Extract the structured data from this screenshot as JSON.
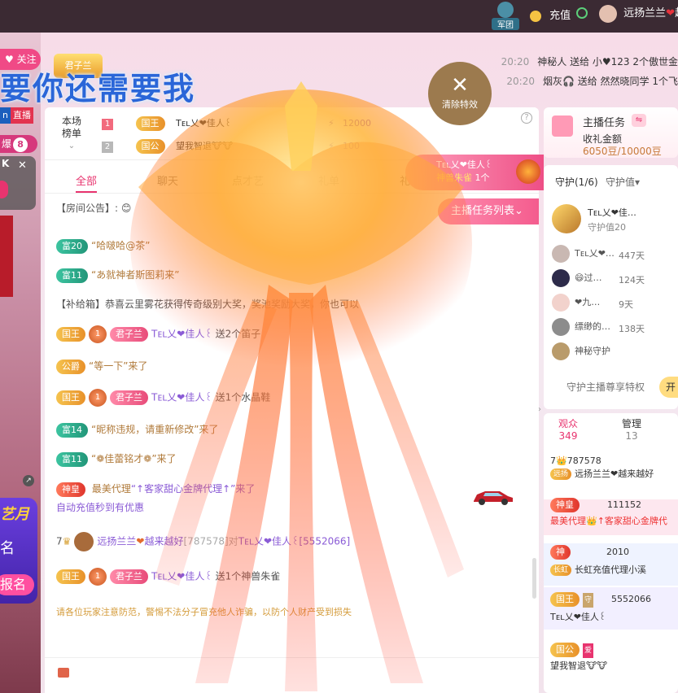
{
  "topbar": {
    "junbtuan": "军团",
    "recharge": "充值",
    "username": "远扬兰兰",
    "heart": "❤",
    "suffix": "越"
  },
  "left": {
    "follow": "关注",
    "live_n": "n",
    "live": "直播",
    "bao": "爆",
    "bao_count": "8",
    "k": "K",
    "close": "✕",
    "promo_title": "艺月",
    "promo_name": "名",
    "promo_btn": "报名"
  },
  "banner": {
    "text": "要你还需要我",
    "badge": "君子兰"
  },
  "ticker": [
    {
      "time": "20:20",
      "text": "神秘人 送给 小♥123 2个傲世金"
    },
    {
      "time": "20:20",
      "text": "烟灰🎧 送给 然然晓同学 1个飞"
    }
  ],
  "clear_effects": {
    "icon": "✕",
    "label": "清除特效"
  },
  "rank": {
    "title": "本场榜单",
    "help": "?",
    "rows": [
      {
        "num": "1",
        "title": "国王",
        "name": "Tᴇʟ乂❤佳人꒰",
        "score": "12000"
      },
      {
        "num": "2",
        "title": "国公",
        "name": "望我智退🐮🐮",
        "score": "100"
      }
    ]
  },
  "tabs": [
    "全部",
    "聊天",
    "点才艺",
    "礼单",
    "礼"
  ],
  "gift_popup": {
    "user": "Tᴇʟ乂❤佳人꒰",
    "gift": "神兽朱雀",
    "count": "1个"
  },
  "anchor_task_list": "主播任务列表",
  "messages": {
    "notice": "【房间公告】:",
    "m1_badge": "富20",
    "m1": "“哈啵哈@茶”",
    "m2_badge": "富11",
    "m2": "“あ就神者斯图莉来”",
    "m3": "【补给箱】恭喜云里雾花获得传奇级别大奖，奖池奖励大奖，你也可以",
    "m4_title": "国王",
    "m4_lv": "1",
    "m4_club": "君子兰",
    "m4_user": "Tᴇʟ乂❤佳人꒰",
    "m4": "送2个笛子",
    "m5_title": "公爵",
    "m5": "“等一下”来了",
    "m6_title": "国王",
    "m6_lv": "1",
    "m6_club": "君子兰",
    "m6_user": "Tᴇʟ乂❤佳人꒰",
    "m6": "送1个水晶鞋",
    "m7_badge": "富14",
    "m7": "“昵称违规，请重新修改”来了",
    "m8_badge": "富11",
    "m8": "“❁佳蕾铭才❁”来了",
    "m9_title": "神皇",
    "m9_agent": "最美代理",
    "m9": "“↑客家甜心金牌代理↑”来了",
    "m9b": "自动充值秒到有优惠",
    "m10_rank": "7",
    "m10_user": "远扬兰兰",
    "m10": "越来越好",
    "m10_mid": "[787578]对",
    "m10_to": "Tᴇʟ乂❤佳人꒰[5552066]",
    "m11_title": "国王",
    "m11_lv": "1",
    "m11_club": "君子兰",
    "m11_user": "Tᴇʟ乂❤佳人꒰",
    "m11": "送1个神兽朱雀",
    "warning": "请各位玩家注意防范，警惕不法分子冒充他人诈骗，以防个人财产受到损失"
  },
  "task_card": {
    "title": "主播任务",
    "sub": "收礼金额",
    "progress": "6050豆/10000豆"
  },
  "guard": {
    "tab1": "守护(1/6)",
    "tab2": "守护值",
    "top_name": "Tᴇʟ乂❤佳…",
    "top_val": "守护值20",
    "rows": [
      {
        "name": "Tᴇʟ乂❤…",
        "days": "447天"
      },
      {
        "name": "😄过…",
        "days": "124天"
      },
      {
        "name": "❤九…",
        "days": "9天"
      },
      {
        "name": "缥缈的…",
        "days": "138天"
      },
      {
        "name": "神秘守护",
        "days": ""
      }
    ],
    "privilege": "守护主播尊享特权",
    "open": "开"
  },
  "audience": {
    "tab1": "观众",
    "tab1_count": "349",
    "tab2": "管理",
    "tab2_count": "13",
    "rows": [
      {
        "line1": "7👑787578",
        "line2": "远扬兰兰❤越来越好",
        "tag": "远扬"
      },
      {
        "title": "神皇",
        "id": "111152",
        "line2": "最美代理👑↑客家甜心金牌代"
      },
      {
        "title": "神",
        "id": "2010",
        "line2": "长虹充值代理小溪",
        "tag": "长虹"
      },
      {
        "title": "国王",
        "tag": "守",
        "id": "5552066",
        "line2": "Tᴇʟ乂❤佳人꒰"
      },
      {
        "title": "国公",
        "tag": "爱",
        "line2": "望我智退🐮🐮"
      }
    ]
  },
  "colors": {
    "accent": "#e8346f",
    "gold": "#e8912a",
    "green": "#229679"
  }
}
